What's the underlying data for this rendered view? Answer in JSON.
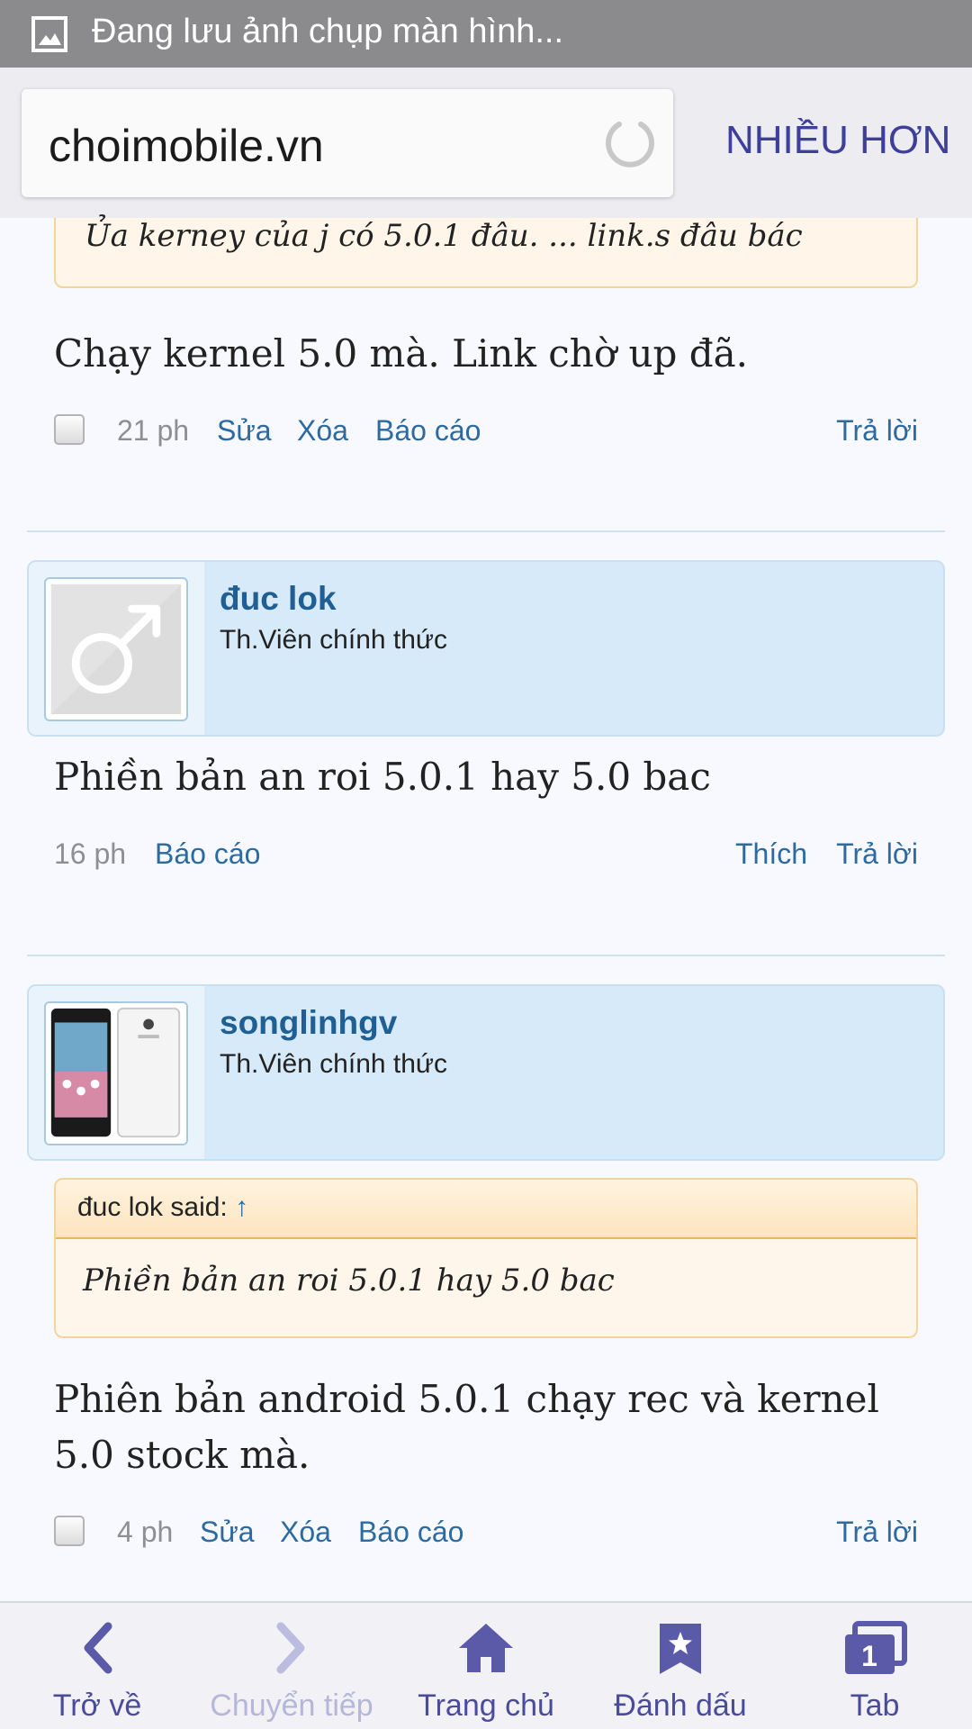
{
  "status_bar": {
    "notification_text": "Đang lưu ảnh chụp màn hình..."
  },
  "browser": {
    "url": "choimobile.vn",
    "more_label": "NHIỀU HƠN"
  },
  "posts": [
    {
      "quote_text": "Ủa kerney của j có 5.0.1 đâu. ... link.s đâu bác",
      "text": "Chạy kernel 5.0 mà. Link chờ up đã.",
      "time": "21 ph",
      "actions": {
        "edit": "Sửa",
        "delete": "Xóa",
        "report": "Báo cáo",
        "reply": "Trả lời"
      }
    },
    {
      "username": "đuc lok",
      "user_title": "Th.Viên chính thức",
      "text": "Phiền bản an roi 5.0.1 hay 5.0 bac",
      "time": "16 ph",
      "actions": {
        "report": "Báo cáo",
        "like": "Thích",
        "reply": "Trả lời"
      }
    },
    {
      "username": "songlinhgv",
      "user_title": "Th.Viên chính thức",
      "quote_author": "đuc lok said:",
      "quote_arrow": "↑",
      "quote_text": "Phiền bản an roi 5.0.1 hay 5.0 bac",
      "text": "Phiên bản android 5.0.1 chạy rec và kernel 5.0 stock mà.",
      "time": "4 ph",
      "actions": {
        "edit": "Sửa",
        "delete": "Xóa",
        "report": "Báo cáo",
        "reply": "Trả lời"
      }
    }
  ],
  "bottom_nav": {
    "back": "Trở về",
    "forward": "Chuyển tiếp",
    "home": "Trang chủ",
    "bookmark": "Đánh dấu",
    "tabs": "Tab",
    "tab_count": "1"
  },
  "colors": {
    "accent": "#4b4b9c",
    "link": "#2b6aa2",
    "username": "#1f5f93",
    "user_panel": "#d6eaf9",
    "quote_border": "#f3d59b"
  }
}
